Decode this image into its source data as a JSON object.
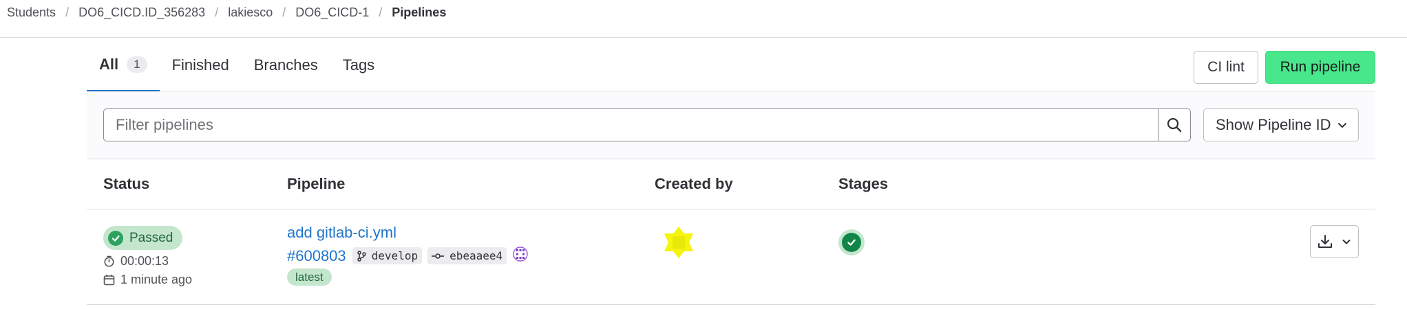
{
  "breadcrumb": {
    "items": [
      "Students",
      "DO6_CICD.ID_356283",
      "lakiesco",
      "DO6_CICD-1",
      "Pipelines"
    ],
    "separator": "/"
  },
  "tabs": [
    {
      "label": "All",
      "count": "1",
      "active": true
    },
    {
      "label": "Finished"
    },
    {
      "label": "Branches"
    },
    {
      "label": "Tags"
    }
  ],
  "actions": {
    "ci_lint_label": "CI lint",
    "run_pipeline_label": "Run pipeline"
  },
  "filter": {
    "placeholder": "Filter pipelines",
    "search_icon": "search-icon",
    "show_id_label": "Show Pipeline ID"
  },
  "table": {
    "headers": [
      "Status",
      "Pipeline",
      "Created by",
      "Stages"
    ],
    "rows": [
      {
        "status": "Passed",
        "duration": "00:00:13",
        "time_ago": "1 minute ago",
        "title": "add gitlab-ci.yml",
        "pipeline_id": "#600803",
        "branch": "develop",
        "commit": "ebeaaee4",
        "badge": "latest",
        "stage_status": "passed"
      }
    ]
  },
  "colors": {
    "accent": "#1f75cb",
    "run_button": "#48e78c",
    "success": "#108548",
    "success_bg": "#c3e6cd"
  }
}
